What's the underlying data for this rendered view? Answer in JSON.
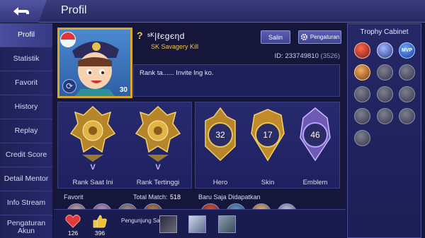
{
  "header": {
    "title": "Profil"
  },
  "sidebar": {
    "items": [
      {
        "label": "Profil",
        "active": true
      },
      {
        "label": "Statistik"
      },
      {
        "label": "Favorit"
      },
      {
        "label": "History"
      },
      {
        "label": "Replay"
      },
      {
        "label": "Credit Score"
      },
      {
        "label": "Detail Mentor"
      },
      {
        "label": "Info Stream"
      },
      {
        "label": "Pengaturan Akun"
      }
    ]
  },
  "profile": {
    "rank_mark": "?",
    "name": "ˢᴷ|ℓєgєηd",
    "squad": "SK Savagery Kill",
    "level": "30",
    "id_label": "ID:",
    "id": "233749810",
    "server": "(3526)",
    "signature": "Rank ta...... Invite lng ko.",
    "copy_button": "Salin",
    "settings_button": "Pengaturan"
  },
  "ranks": [
    {
      "label": "Rank Saat Ini",
      "tier": "V"
    },
    {
      "label": "Rank Tertinggi",
      "tier": "V"
    }
  ],
  "stats": [
    {
      "label": "Hero",
      "value": "32"
    },
    {
      "label": "Skin",
      "value": "17"
    },
    {
      "label": "Emblem",
      "value": "46"
    }
  ],
  "favorites": {
    "title": "Favorit",
    "total_match_label": "Total Match:",
    "total_match": "518"
  },
  "recent": {
    "title": "Baru Saja Didapatkan"
  },
  "bottom": {
    "likes": "126",
    "thumbs": "396",
    "visitors_label": "Pengunjung Saya"
  },
  "trophy": {
    "title": "Trophy Cabinet",
    "mvp_text": "MVP"
  },
  "colors": {
    "gold": "#d9a92c",
    "panel": "#272a6e",
    "accent": "#f2c54c"
  }
}
